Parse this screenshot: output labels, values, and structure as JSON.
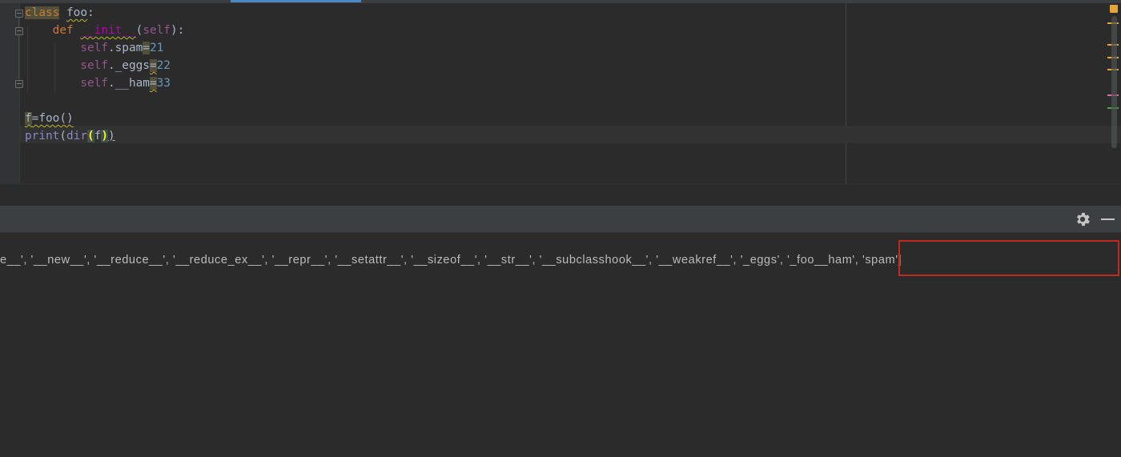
{
  "editor": {
    "lines": {
      "l1": {
        "kw": "class",
        "name": "foo",
        "colon": ":"
      },
      "l2": {
        "kw": "def",
        "fn": "__init__",
        "open": "(",
        "self": "self",
        "close": "):"
      },
      "l3": {
        "self": "self",
        "attr": ".spam",
        "eq": "=",
        "num": "21"
      },
      "l4": {
        "self": "self",
        "attr": "._eggs",
        "eq": "=",
        "num": "22"
      },
      "l5": {
        "self": "self",
        "attr": ".__ham",
        "eq": "=",
        "num": "33"
      },
      "l7": {
        "var": "f",
        "rest": "=foo()"
      },
      "l8": {
        "print": "print",
        "open": "(",
        "dir": "dir",
        "p2": "(",
        "arg": "f",
        "c2": ")",
        "c1": ")"
      }
    }
  },
  "console": {
    "output_line": "e__', '__new__', '__reduce__', '__reduce_ex__', '__repr__', '__setattr__', '__sizeof__', '__str__', '__subclasshook__', '__weakref__', '_eggs', '_foo__ham', 'spam']"
  },
  "panel": {
    "settings_icon": "gear-icon",
    "minimize_icon": "minimize-icon"
  },
  "colors": {
    "keyword": "#cc7832",
    "magic": "#b200b2",
    "self": "#94558d",
    "number": "#6897bb",
    "highlight_box": "#c0291e"
  }
}
